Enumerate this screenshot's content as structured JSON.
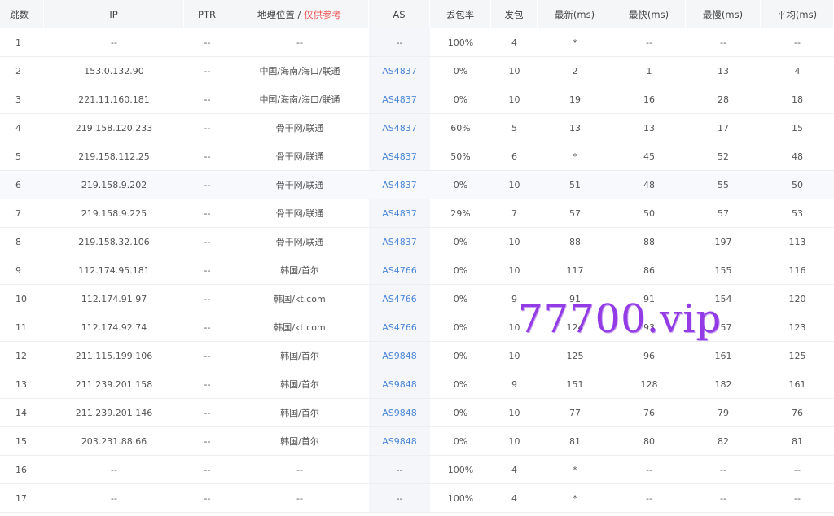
{
  "headers": {
    "hop": "跳数",
    "ip": "IP",
    "ptr": "PTR",
    "geo": "地理位置",
    "geo_sep": " / ",
    "geo_ref": "仅供参考",
    "as": "AS",
    "loss": "丢包率",
    "sent": "发包",
    "last": "最新(ms)",
    "best": "最快(ms)",
    "worst": "最慢(ms)",
    "avg": "平均(ms)"
  },
  "rows": [
    {
      "hop": "1",
      "ip": "--",
      "ptr": "--",
      "geo": "--",
      "as": "--",
      "loss": "100%",
      "sent": "4",
      "last": "*",
      "best": "--",
      "worst": "--",
      "avg": "--"
    },
    {
      "hop": "2",
      "ip": "153.0.132.90",
      "ptr": "--",
      "geo": "中国/海南/海口/联通",
      "as": "AS4837",
      "loss": "0%",
      "sent": "10",
      "last": "2",
      "best": "1",
      "worst": "13",
      "avg": "4"
    },
    {
      "hop": "3",
      "ip": "221.11.160.181",
      "ptr": "--",
      "geo": "中国/海南/海口/联通",
      "as": "AS4837",
      "loss": "0%",
      "sent": "10",
      "last": "19",
      "best": "16",
      "worst": "28",
      "avg": "18"
    },
    {
      "hop": "4",
      "ip": "219.158.120.233",
      "ptr": "--",
      "geo": "骨干网/联通",
      "as": "AS4837",
      "loss": "60%",
      "sent": "5",
      "last": "13",
      "best": "13",
      "worst": "17",
      "avg": "15"
    },
    {
      "hop": "5",
      "ip": "219.158.112.25",
      "ptr": "--",
      "geo": "骨干网/联通",
      "as": "AS4837",
      "loss": "50%",
      "sent": "6",
      "last": "*",
      "best": "45",
      "worst": "52",
      "avg": "48"
    },
    {
      "hop": "6",
      "ip": "219.158.9.202",
      "ptr": "--",
      "geo": "骨干网/联通",
      "as": "AS4837",
      "loss": "0%",
      "sent": "10",
      "last": "51",
      "best": "48",
      "worst": "55",
      "avg": "50"
    },
    {
      "hop": "7",
      "ip": "219.158.9.225",
      "ptr": "--",
      "geo": "骨干网/联通",
      "as": "AS4837",
      "loss": "29%",
      "sent": "7",
      "last": "57",
      "best": "50",
      "worst": "57",
      "avg": "53"
    },
    {
      "hop": "8",
      "ip": "219.158.32.106",
      "ptr": "--",
      "geo": "骨干网/联通",
      "as": "AS4837",
      "loss": "0%",
      "sent": "10",
      "last": "88",
      "best": "88",
      "worst": "197",
      "avg": "113"
    },
    {
      "hop": "9",
      "ip": "112.174.95.181",
      "ptr": "--",
      "geo": "韩国/首尔",
      "as": "AS4766",
      "loss": "0%",
      "sent": "10",
      "last": "117",
      "best": "86",
      "worst": "155",
      "avg": "116"
    },
    {
      "hop": "10",
      "ip": "112.174.91.97",
      "ptr": "--",
      "geo": "韩国/kt.com",
      "as": "AS4766",
      "loss": "0%",
      "sent": "9",
      "last": "91",
      "best": "91",
      "worst": "154",
      "avg": "120"
    },
    {
      "hop": "11",
      "ip": "112.174.92.74",
      "ptr": "--",
      "geo": "韩国/kt.com",
      "as": "AS4766",
      "loss": "0%",
      "sent": "10",
      "last": "124",
      "best": "93",
      "worst": "157",
      "avg": "123"
    },
    {
      "hop": "12",
      "ip": "211.115.199.106",
      "ptr": "--",
      "geo": "韩国/首尔",
      "as": "AS9848",
      "loss": "0%",
      "sent": "10",
      "last": "125",
      "best": "96",
      "worst": "161",
      "avg": "125"
    },
    {
      "hop": "13",
      "ip": "211.239.201.158",
      "ptr": "--",
      "geo": "韩国/首尔",
      "as": "AS9848",
      "loss": "0%",
      "sent": "9",
      "last": "151",
      "best": "128",
      "worst": "182",
      "avg": "161"
    },
    {
      "hop": "14",
      "ip": "211.239.201.146",
      "ptr": "--",
      "geo": "韩国/首尔",
      "as": "AS9848",
      "loss": "0%",
      "sent": "10",
      "last": "77",
      "best": "76",
      "worst": "79",
      "avg": "76"
    },
    {
      "hop": "15",
      "ip": "203.231.88.66",
      "ptr": "--",
      "geo": "韩国/首尔",
      "as": "AS9848",
      "loss": "0%",
      "sent": "10",
      "last": "81",
      "best": "80",
      "worst": "82",
      "avg": "81"
    },
    {
      "hop": "16",
      "ip": "--",
      "ptr": "--",
      "geo": "--",
      "as": "--",
      "loss": "100%",
      "sent": "4",
      "last": "*",
      "best": "--",
      "worst": "--",
      "avg": "--"
    },
    {
      "hop": "17",
      "ip": "--",
      "ptr": "--",
      "geo": "--",
      "as": "--",
      "loss": "100%",
      "sent": "4",
      "last": "*",
      "best": "--",
      "worst": "--",
      "avg": "--"
    }
  ],
  "highlighted_row": 5,
  "colors": {
    "link": "#4a86d8",
    "reference": "#f0504f",
    "watermark": "#8a2be2"
  },
  "watermark": "77700.vip"
}
